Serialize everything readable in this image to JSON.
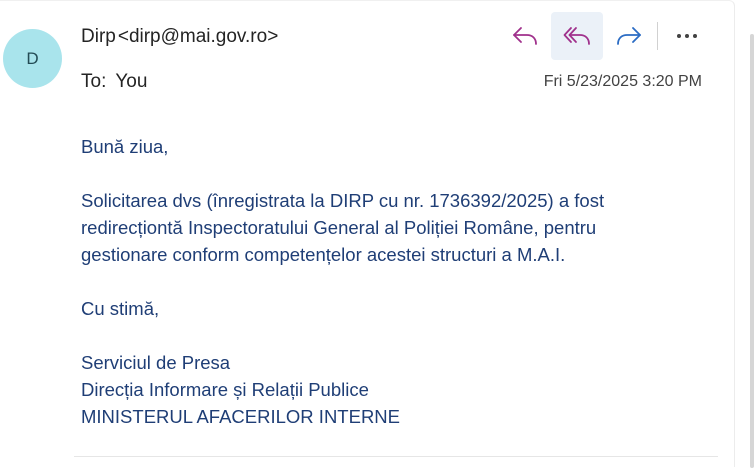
{
  "message": {
    "avatar_initial": "D",
    "sender_name": "Dirp",
    "sender_email": "<dirp@mai.gov.ro>",
    "to_label": "To:",
    "to_value": "You",
    "timestamp": "Fri 5/23/2025 3:20 PM"
  },
  "actions": {
    "reply_icon": "reply-icon",
    "reply_all_icon": "reply-all-icon",
    "forward_icon": "forward-icon",
    "more_icon": "more-options-icon",
    "accent_color": "#a0318c",
    "forward_color": "#2b6cc4"
  },
  "body": {
    "greeting": "Bună ziua,",
    "para_line1": "Solicitarea dvs (înregistrata la DIRP cu nr. 1736392/2025) a fost",
    "para_line2": "redirecționtă Inspectoratului General al Poliției Române, pentru",
    "para_line3": "gestionare conform competențelor acestei structuri a M.A.I.",
    "closing": "Cu stimă,",
    "sig_line1": "Serviciul de Presa",
    "sig_line2": "Direcția Informare și Relații Publice",
    "sig_line3": "MINISTERUL AFACERILOR INTERNE",
    "text_color": "#1f3e76"
  }
}
